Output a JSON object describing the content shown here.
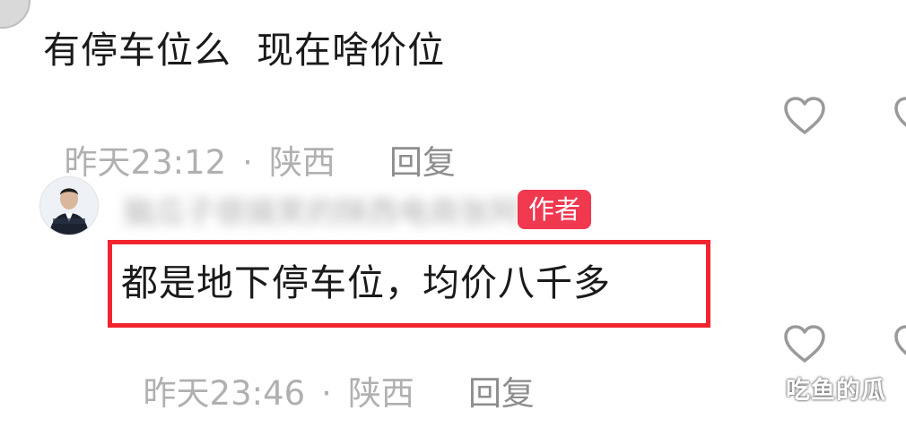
{
  "comment": {
    "text": "有停车位么  现在啥价位",
    "time": "昨天23:12",
    "separator": "·",
    "location": "陕西",
    "reply_label": "回复"
  },
  "author_reply": {
    "name_blurred": "脑瓜子很搞笑的陕西电商张阿",
    "badge": "作者",
    "text": "都是地下停车位，均价八千多",
    "time": "昨天23:46",
    "separator": "·",
    "location": "陕西",
    "reply_label": "回复"
  },
  "icons": {
    "like": "heart-outline-icon"
  },
  "colors": {
    "badge": "#f0384f",
    "highlight": "#f0252e",
    "meta_text": "#b0b0b0"
  },
  "watermark": "吃鱼的瓜"
}
